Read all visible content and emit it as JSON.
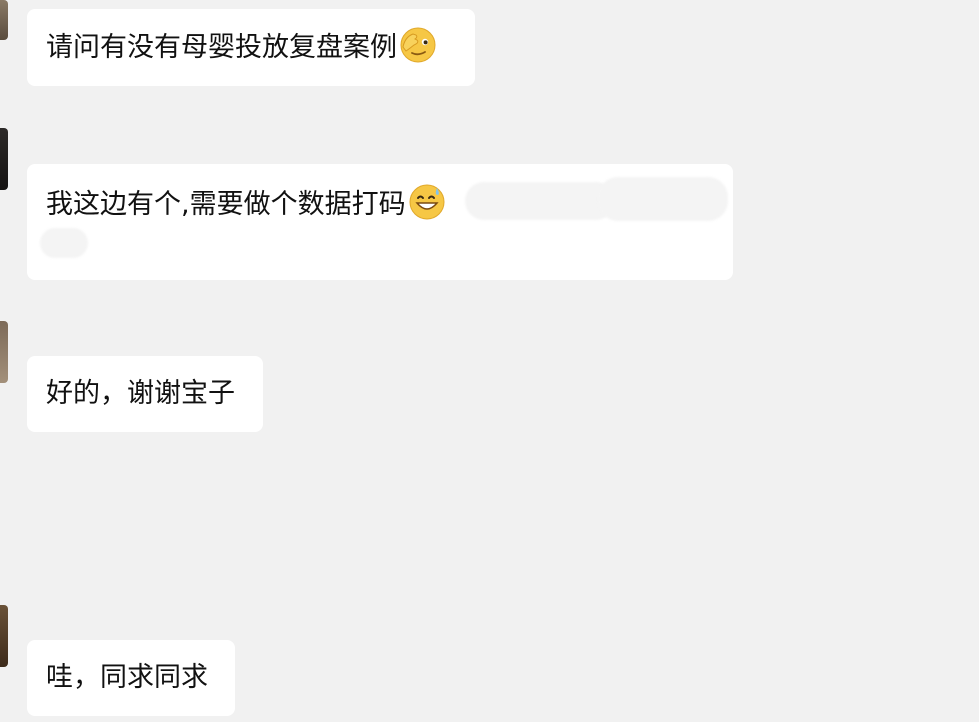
{
  "messages": [
    {
      "text": "请问有没有母婴投放复盘案例",
      "emoji": "face-with-hand-over-eye-icon"
    },
    {
      "text": "我这边有个,需要做个数据打码",
      "emoji": "grinning-face-with-sweat-icon"
    },
    {
      "text": "好的，谢谢宝子"
    },
    {
      "text": "哇，同求同求"
    }
  ],
  "colors": {
    "background": "#f1f1f1",
    "bubble": "#ffffff",
    "text": "#111111"
  }
}
